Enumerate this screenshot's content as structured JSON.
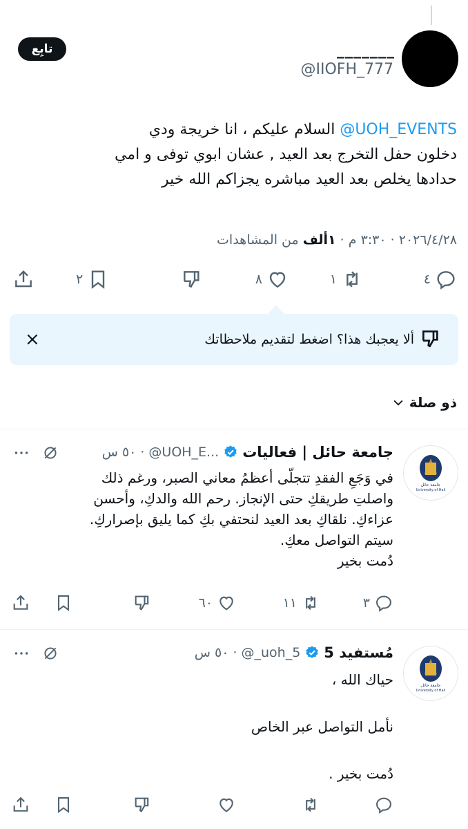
{
  "main_tweet": {
    "display_name": "_______",
    "handle": "@IIOFH_777",
    "follow_label": "تابِع",
    "mention": "@UOH_EVENTS",
    "text_line1_rest": " السلام عليكم ، انا خريجة ودي",
    "text_line2": "دخلون حفل التخرج بعد العيد , عشان ابوي توفى و امي",
    "text_line3": "حدادها يخلص بعد العيد مباشره يجزاكم الله خير",
    "date": "٢٠٢٦/٤/٢٨",
    "time": "٣:٣٠ م",
    "views_count": "١ألف",
    "views_label": "من المشاهدات",
    "actions": {
      "replies": "٤",
      "retweets": "١",
      "likes": "٨",
      "bookmarks": "٢"
    }
  },
  "feedback_banner": {
    "text": "ألا يعجبك هذا؟ اضغط لتقديم ملاحظاتك",
    "close": "×"
  },
  "related_header": "ذو صلة",
  "replies": [
    {
      "display_name": "جامعة حائل | فعاليات",
      "handle": "@UOH_E...",
      "time": "٥٠ س",
      "lines": [
        "في وَجَعِ الفقدِ تتجلّى أعظمُ معاني الصبر، ورغم ذلك",
        "واصلتِ طريقكِ حتى الإنجاز. رحم الله والدكِ، وأحسن",
        "عزاءكِ. نلقاكِ بعد العيد لنحتفي بكِ كما يليق بإصراركِ.",
        "سيتم التواصل معكِ.",
        "دُمت بخير"
      ],
      "actions": {
        "replies": "٣",
        "retweets": "١١",
        "likes": "٦٠"
      }
    },
    {
      "display_name": "مُستفيد 5",
      "handle": "@_uoh_5",
      "time": "٥٠ س",
      "lines": [
        "حياك الله ،",
        "",
        "نأمل التواصل عبر الخاص",
        "",
        "دُمت بخير ."
      ],
      "actions": {
        "replies": "",
        "retweets": "",
        "likes": ""
      }
    }
  ],
  "colors": {
    "accent": "#1d9bf0",
    "text": "#0f1419",
    "muted": "#536471",
    "banner_bg": "#eaf6fd",
    "divider": "#eff3f4"
  },
  "icons": [
    "reply-icon",
    "retweet-icon",
    "like-icon",
    "dislike-icon",
    "bookmark-icon",
    "share-icon",
    "verified-icon",
    "grok-icon",
    "more-icon",
    "chevron-down-icon",
    "close-icon"
  ]
}
